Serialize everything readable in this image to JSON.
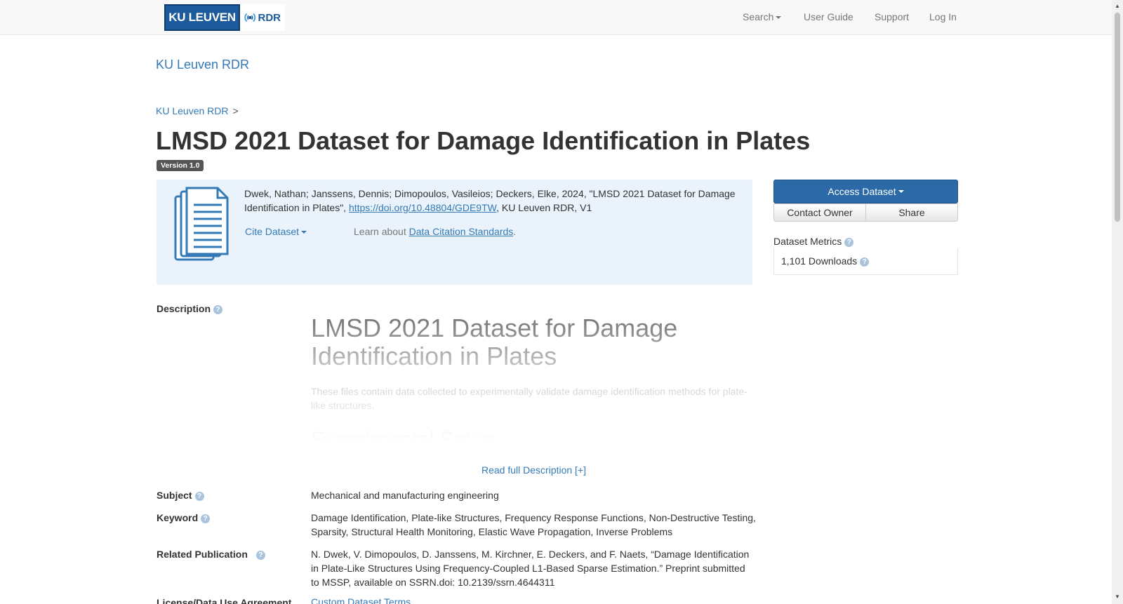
{
  "nav": {
    "logo_ku": "KU LEUVEN",
    "logo_rdr": "RDR",
    "search": "Search",
    "user_guide": "User Guide",
    "support": "Support",
    "login": "Log In"
  },
  "dataverse_link": "KU Leuven RDR",
  "breadcrumb": {
    "root": "KU Leuven RDR",
    "separator": ">"
  },
  "title": "LMSD 2021 Dataset for Damage Identification in Plates",
  "version": "Version 1.0",
  "citation": {
    "text_before": "Dwek, Nathan; Janssens, Dennis; Dimopoulos, Vasileios; Deckers, Elke, 2024, \"LMSD 2021 Dataset for Damage Identification in Plates\", ",
    "doi": "https://doi.org/10.48804/GDE9TW",
    "text_after": ", KU Leuven RDR, V1",
    "cite_button": "Cite Dataset",
    "learn_prefix": "Learn about ",
    "learn_link": "Data Citation Standards",
    "learn_suffix": "."
  },
  "actions": {
    "access": "Access Dataset",
    "contact": "Contact Owner",
    "share": "Share"
  },
  "metrics": {
    "label": "Dataset Metrics",
    "downloads": "1,101 Downloads"
  },
  "fields": {
    "description_label": "Description",
    "description_heading": "LMSD 2021 Dataset for Damage Identification in Plates",
    "description_text": "These files contain data collected to experimentally validate damage identification methods for plate-like structures.",
    "description_subheading": "Experimental Setup",
    "read_more": "Read full Description [+]",
    "subject_label": "Subject",
    "subject_value": "Mechanical and manufacturing engineering",
    "keyword_label": "Keyword",
    "keyword_value": "Damage Identification, Plate-like Structures, Frequency Response Functions, Non-Destructive Testing, Sparsity, Structural Health Monitoring, Elastic Wave Propagation, Inverse Problems",
    "related_label": "Related Publication",
    "related_value": "N. Dwek, V. Dimopoulos, D. Janssens, M. Kirchner, E. Deckers, and F. Naets, “Damage Identification in Plate-Like Structures Using Frequency-Coupled L1-Based Sparse Estimation.” Preprint submitted to MSSP, available on SSRN.doi: 10.2139/ssrn.4644311",
    "license_label": "License/Data Use Agreement",
    "license_value": "Custom Dataset Terms"
  },
  "colors": {
    "link": "#337ab7",
    "primary": "#2b6aa6",
    "citation_bg": "#eaf3fb",
    "logo_blue": "#1d5a9c"
  }
}
